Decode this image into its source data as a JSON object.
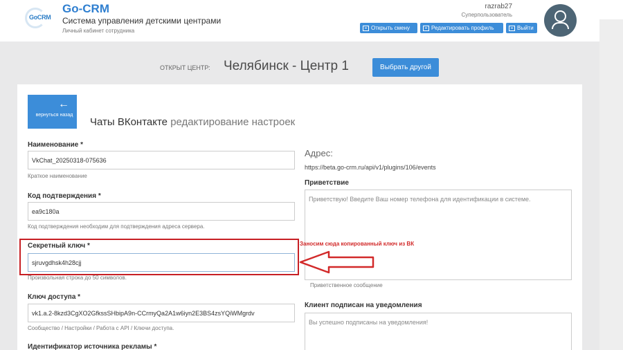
{
  "header": {
    "logo_text": "GoCRM",
    "brand": "Go-CRM",
    "subtitle": "Система управления детскими центрами",
    "cabinet": "Личный кабинет сотрудника",
    "username": "razrab27",
    "role": "Суперпользователь",
    "buttons": {
      "open_shift": "Открыть смену",
      "edit_profile": "Редактировать профиль",
      "logout": "Выйти"
    }
  },
  "center": {
    "label": "ОТКРЫТ ЦЕНТР:",
    "name": "Челябинск - Центр 1",
    "choose_button": "Выбрать другой"
  },
  "page": {
    "back_button": "вернуться назад",
    "title": "Чаты ВКонтакте",
    "title_suffix": "редактирование настроек"
  },
  "form": {
    "name": {
      "label": "Наименование *",
      "value": "VkChat_20250318-075636",
      "hint": "Краткое наименование"
    },
    "confirm_code": {
      "label": "Код подтверждения *",
      "value": "ea9c180a",
      "hint": "Код подтверждения необходим для подтверждения адреса сервера."
    },
    "secret_key": {
      "label": "Секретный ключ *",
      "value": "sjruvgdhsk4h28cjj",
      "hint": "Произвольная строка до 50 символов."
    },
    "access_key": {
      "label": "Ключ доступа *",
      "value": "vk1.a.2-8kzd3CgXO2GfkssSHbipA9n-CCrmyQa2A1w6iyn2E3BS4zsYQiWMgrdv",
      "hint": "Сообщество / Настройки / Работа с API / Ключи доступа."
    },
    "ad_source": {
      "label": "Идентификатор источника рекламы *"
    }
  },
  "right": {
    "address_label": "Адрес:",
    "address_value": "https://beta.go-crm.ru/api/v1/plugins/106/events",
    "greeting_label": "Приветствие",
    "greeting_value": "Приветствую! Введите Ваш номер телефона для идентификации в системе.",
    "greeting_hint": "Приветственное сообщение",
    "subscribed_label": "Клиент подписан на уведомления",
    "subscribed_value": "Вы успешно подписаны на уведомления!"
  },
  "annotation": {
    "note": "Заносим сюда копированный ключ из ВК",
    "color": "#d22a2a"
  },
  "icons": [
    "arrow-left-icon",
    "enter-icon",
    "edit-icon",
    "exit-icon",
    "user-avatar-icon",
    "red-arrow-icon"
  ]
}
